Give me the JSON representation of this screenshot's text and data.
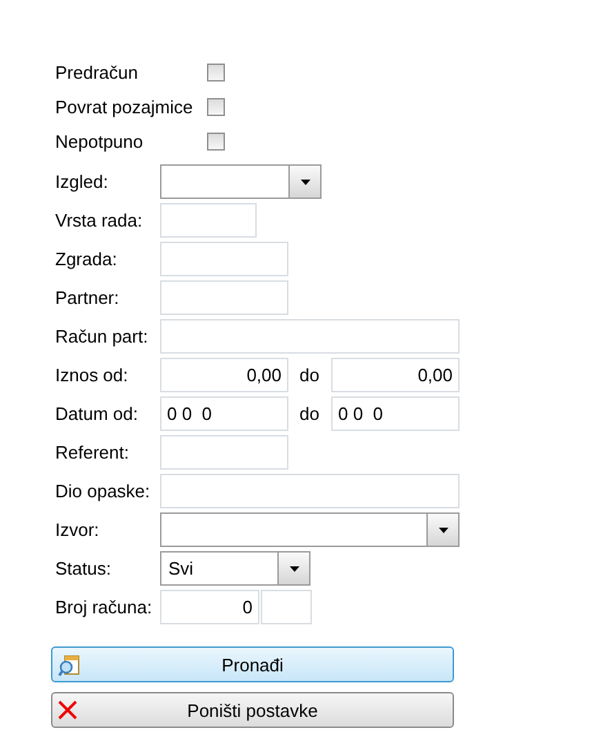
{
  "checkboxes": [
    {
      "label": "Predračun",
      "checked": false
    },
    {
      "label": "Povrat pozajmice",
      "checked": false
    },
    {
      "label": "Nepotpuno",
      "checked": false
    }
  ],
  "fields": [
    {
      "kind": "select",
      "label": "Izgled:"
    },
    {
      "kind": "text",
      "label": "Vrsta rada:"
    },
    {
      "kind": "text",
      "label": "Zgrada:"
    },
    {
      "kind": "text",
      "label": "Partner:"
    },
    {
      "kind": "text",
      "label": "Račun part:"
    },
    {
      "kind": "amount-range",
      "label": "Iznos od:",
      "from": "0,00",
      "separator": "do",
      "to": "0,00"
    },
    {
      "kind": "date-range",
      "label": "Datum od:",
      "from": "0 0  0",
      "separator": "do",
      "to": "0 0  0"
    },
    {
      "kind": "text",
      "label": "Referent:"
    },
    {
      "kind": "text",
      "label": "Dio opaske:"
    },
    {
      "kind": "select",
      "label": "Izvor:"
    },
    {
      "kind": "select",
      "label": "Status:",
      "value": "Svi"
    },
    {
      "kind": "number-pair",
      "label": "Broj računa:",
      "value": "0"
    }
  ],
  "buttons": [
    {
      "kind": "search",
      "label": "Pronađi"
    },
    {
      "kind": "reset",
      "label": "Poništi postavke"
    }
  ]
}
